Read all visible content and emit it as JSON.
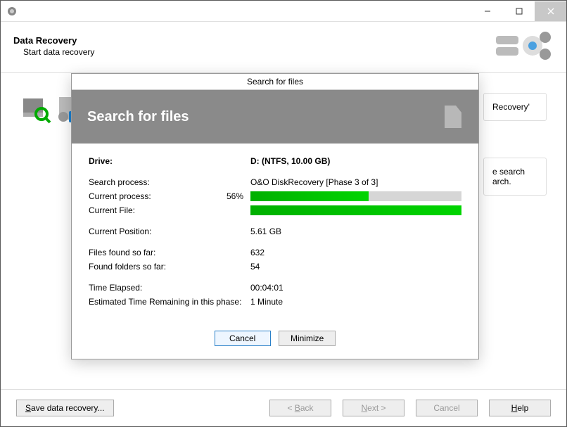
{
  "header": {
    "title": "Data Recovery",
    "subtitle": "Start data recovery"
  },
  "bg": {
    "right1": "Recovery'",
    "right2a": "e search",
    "right2b": "arch."
  },
  "dialog": {
    "titlebar": "Search for files",
    "heading": "Search for files",
    "drive_label": "Drive:",
    "drive_value": "D: (NTFS, 10.00 GB)",
    "search_process_label": "Search process:",
    "search_process_value": "O&O DiskRecovery [Phase 3 of 3]",
    "current_process_label": "Current process:",
    "current_process_pct": "56%",
    "current_process_fill": 56,
    "current_file_label": "Current File:",
    "current_file_fill": 100,
    "current_position_label": "Current Position:",
    "current_position_value": "5.61 GB",
    "files_found_label": "Files found so far:",
    "files_found_value": "632",
    "folders_found_label": "Found folders so far:",
    "folders_found_value": "54",
    "time_elapsed_label": "Time Elapsed:",
    "time_elapsed_value": "00:04:01",
    "eta_label": "Estimated Time Remaining in this phase:",
    "eta_value": "1 Minute",
    "cancel": "Cancel",
    "minimize": "Minimize"
  },
  "footer": {
    "save": "Save data recovery...",
    "back": "< Back",
    "next": "Next >",
    "cancel": "Cancel",
    "help": "Help"
  }
}
